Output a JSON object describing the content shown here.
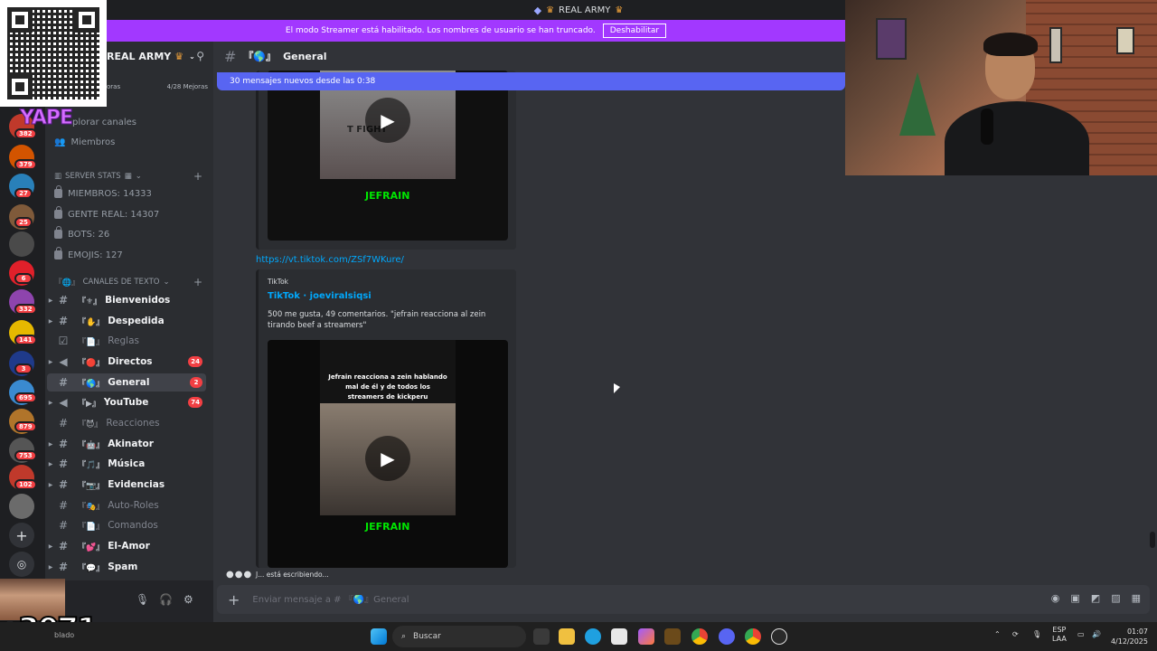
{
  "titlebar": {
    "title": "REAL ARMY"
  },
  "banner": {
    "text": "El modo Streamer está habilitado. Los nombres de usuario se han truncado.",
    "button": "Deshabilitar"
  },
  "overlay": {
    "yape": "YAPE",
    "counter": "x3071"
  },
  "rail": {
    "badges": [
      "382",
      "379",
      "27",
      "25",
      "6",
      "332",
      "141",
      "3",
      "695",
      "879",
      "753",
      "102"
    ]
  },
  "server": {
    "name": "REAL ARMY",
    "boost_left": "oras",
    "boost_right": "4/28 Mejoras",
    "nav": [
      "plorar canales",
      "Miembros"
    ]
  },
  "stats_category": "SERVER STATS",
  "stats": [
    "MIEMBROS: 14333",
    "GENTE REAL: 14307",
    "BOTS: 26",
    "EMOJIS: 127"
  ],
  "text_category": "CANALES DE TEXTO",
  "channels": [
    {
      "name": "Bienvenidos",
      "count": ""
    },
    {
      "name": "Despedida",
      "count": ""
    },
    {
      "name": "Reglas",
      "count": ""
    },
    {
      "name": "Directos",
      "count": "24"
    },
    {
      "name": "General",
      "count": "2"
    },
    {
      "name": "YouTube",
      "count": "74"
    },
    {
      "name": "Reacciones",
      "count": ""
    },
    {
      "name": "Akinator",
      "count": ""
    },
    {
      "name": "Música",
      "count": ""
    },
    {
      "name": "Evidencias",
      "count": ""
    },
    {
      "name": "Auto-Roles",
      "count": ""
    },
    {
      "name": "Comandos",
      "count": ""
    },
    {
      "name": "El-Amor",
      "count": ""
    },
    {
      "name": "Spam",
      "count": ""
    }
  ],
  "chat": {
    "channel": "General",
    "new_messages": "30 mensajes nuevos desde las 0:38",
    "link": "https://vt.tiktok.com/ZSf7WKure/",
    "embed": {
      "provider": "TikTok",
      "title": "TikTok · joeviralsiqsi",
      "description": "500 me gusta, 49 comentarios. \"jefrain reacciona al zein tirando beef a streamers\"",
      "video_caption": "Jefrain reacciona a zein hablando mal de él y de todos los streamers de kickperu",
      "video_logo": "JEFRAIN",
      "top_video_text": "T FIGHT",
      "top_video_logo": "JEFRAIN"
    },
    "typing": "J... está escribiendo...",
    "composer_placeholder": "Enviar mensaje a # 『🌎』General"
  },
  "taskbar": {
    "search": "Buscar",
    "lang1": "ESP",
    "lang2": "LAA",
    "time": "01:07",
    "date": "4/12/2025",
    "left_text": "blado"
  }
}
